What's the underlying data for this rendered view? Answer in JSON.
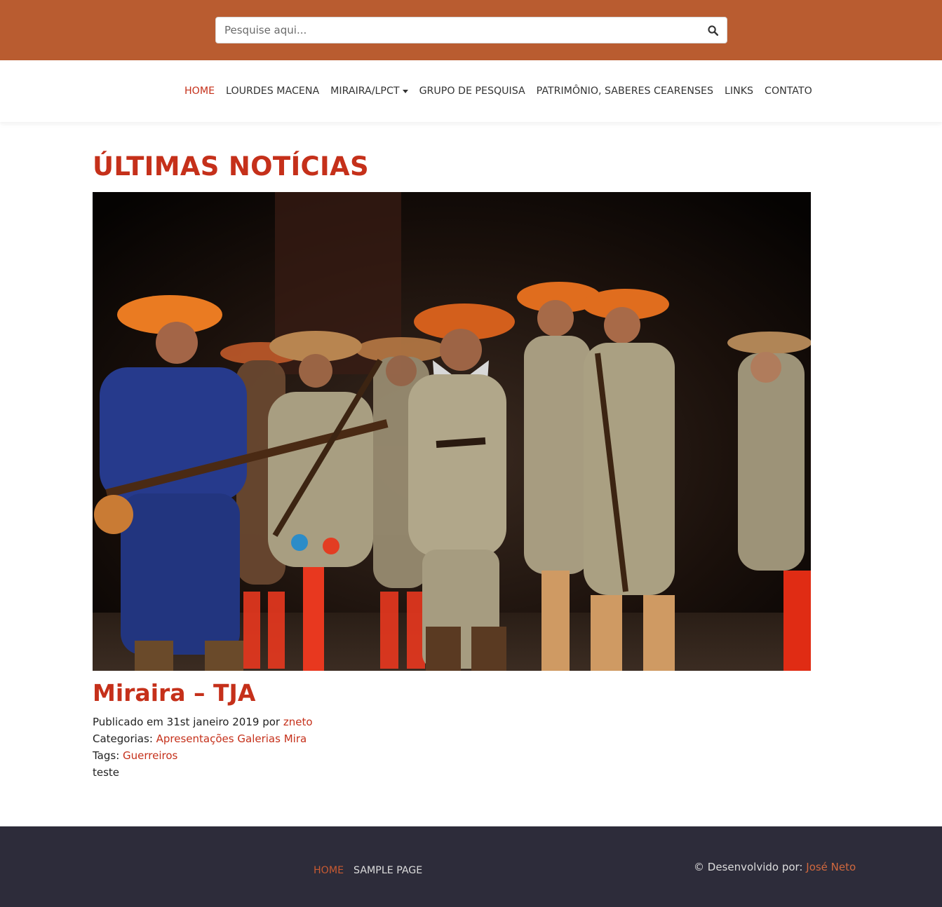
{
  "header": {
    "search_placeholder": "Pesquise aqui...",
    "search_icon": "search-icon",
    "bg_color": "#b95c30"
  },
  "nav": {
    "items": [
      {
        "label": "HOME",
        "active": true
      },
      {
        "label": "LOURDES MACENA"
      },
      {
        "label": "MIRAIRA/LPCT",
        "dropdown": true
      },
      {
        "label": "GRUPO DE PESQUISA"
      },
      {
        "label": "PATRIMÔNIO, SABERES CEARENSES"
      },
      {
        "label": "LINKS"
      },
      {
        "label": "CONTATO"
      }
    ]
  },
  "main": {
    "section_title": "ÚLTIMAS NOTÍCIAS",
    "post": {
      "title": "Miraira – TJA",
      "published_prefix": "Publicado em 31st janeiro 2019 por ",
      "author": "zneto",
      "categories_prefix": "Categorias: ",
      "categories": [
        "Apresentações",
        "Galerias",
        "Mira"
      ],
      "tags_prefix": "Tags: ",
      "tags": [
        "Guerreiros"
      ],
      "excerpt": "teste"
    }
  },
  "footer": {
    "nav": [
      {
        "label": "HOME",
        "active": true
      },
      {
        "label": "SAMPLE PAGE"
      }
    ],
    "credit_prefix": "© Desenvolvido por: ",
    "credit_author": "José Neto",
    "bg_color": "#2d2c3a"
  },
  "accent_color": "#c5301a"
}
